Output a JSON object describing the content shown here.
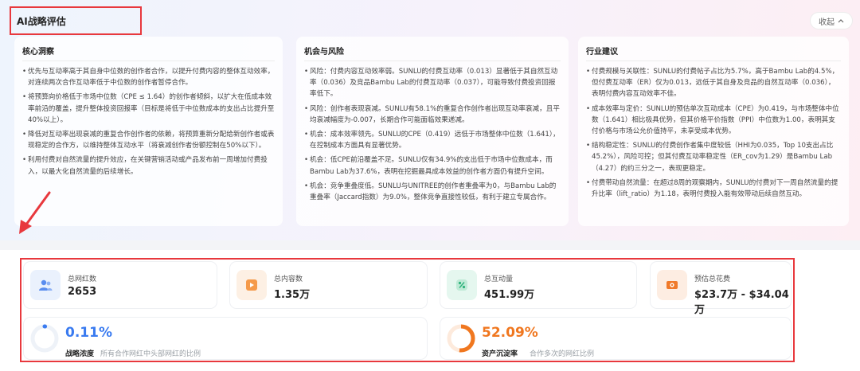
{
  "header": {
    "title": "AI战略评估",
    "collapse_label": "收起"
  },
  "cards": {
    "insights": {
      "title": "核心洞察",
      "items": [
        "优先与互动率高于其自身中位数的创作者合作，以提升付费内容的整体互动效率，对连续两次合作互动率低于中位数的创作者暂停合作。",
        "将预算向价格低于市场中位数（CPE ≤ 1.64）的创作者倾斜，以扩大在低成本效率前沿的覆盖，提升整体投资回报率（目标是将低于中位数成本的支出占比提升至40%以上）。",
        "降低对互动率出现衰减的重复合作创作者的依赖，将预算重新分配给新创作者或表现稳定的合作方，以维持整体互动水平（将衰减创作者份额控制在50%以下）。",
        "利用付费对自然流量的提升效应，在关键营销活动或产品发布前一周增加付费投入，以最大化自然流量的后续增长。"
      ]
    },
    "risks": {
      "title": "机会与风险",
      "items": [
        "风险：付费内容互动效率弱。SUNLU的付费互动率（0.013）显著低于其自然互动率（0.036）及竞品Bambu Lab的付费互动率（0.037），可能导致付费投资回报率低下。",
        "风险：创作者表现衰减。SUNLU有58.1%的重复合作创作者出现互动率衰减，且平均衰减幅度为-0.007，长期合作可能面临效果递减。",
        "机会：成本效率领先。SUNLU的CPE（0.419）远低于市场整体中位数（1.641），在控制成本方面具有显著优势。",
        "机会：低CPE前沿覆盖不足。SUNLU仅有34.9%的支出低于市场中位数成本，而Bambu Lab为37.6%，表明在挖掘最具成本效益的创作者方面仍有提升空间。",
        "机会：竞争重叠度低。SUNLU与UNITREE的创作者重叠率为0，与Bambu Lab的重叠率（Jaccard指数）为9.0%，整体竞争直接性较低，有利于建立专属合作。"
      ]
    },
    "advice": {
      "title": "行业建议",
      "items": [
        "付费规模与关联性：SUNLU的付费帖子占比为5.7%，高于Bambu Lab的4.5%，但付费互动率（ER）仅为0.013，远低于其自身及竞品的自然互动率（0.036），表明付费内容互动效率不佳。",
        "成本效率与定价：SUNLU的预估单次互动成本（CPE）为0.419，与市场整体中位数（1.641）相比极具优势，但其价格平价指数（PPI）中位数为1.00，表明其支付价格与市场公允价值持平，未享受成本优势。",
        "结构稳定性：SUNLU的付费创作者集中度较低（HHI为0.035，Top 10支出占比45.2%），风险可控；但其付费互动率稳定性（ER_cov为1.29）是Bambu Lab（4.27）的约三分之一，表现更稳定。",
        "付费带动自然流量：在超过8周的观察期内，SUNLU的付费对下一周自然流量的提升比率（lift_ratio）为1.18，表明付费投入能有效带动后续自然互动。"
      ]
    }
  },
  "stats": {
    "influencers": {
      "label": "总网红数",
      "value": "2653",
      "icon": "people-icon",
      "color": "#5b8def"
    },
    "contents": {
      "label": "总内容数",
      "value": "1.35万",
      "icon": "video-icon",
      "color": "#f59a4a"
    },
    "interactions": {
      "label": "总互动量",
      "value": "451.99万",
      "icon": "percent-icon",
      "color": "#3cc58e"
    },
    "cost": {
      "label": "预估总花费",
      "value": "$23.7万 - $34.04万",
      "icon": "money-icon",
      "color": "#f07a2a"
    }
  },
  "rings": {
    "strategy": {
      "percent_text": "0.11%",
      "fraction": 0.0011,
      "label": "战略浓度",
      "desc": "所有合作网红中头部网红的比例",
      "color": "#3a7bf0"
    },
    "retention": {
      "percent_text": "52.09%",
      "fraction": 0.5209,
      "label": "资产沉淀率",
      "desc": "合作多次的网红比例",
      "color": "#f0771f"
    }
  }
}
